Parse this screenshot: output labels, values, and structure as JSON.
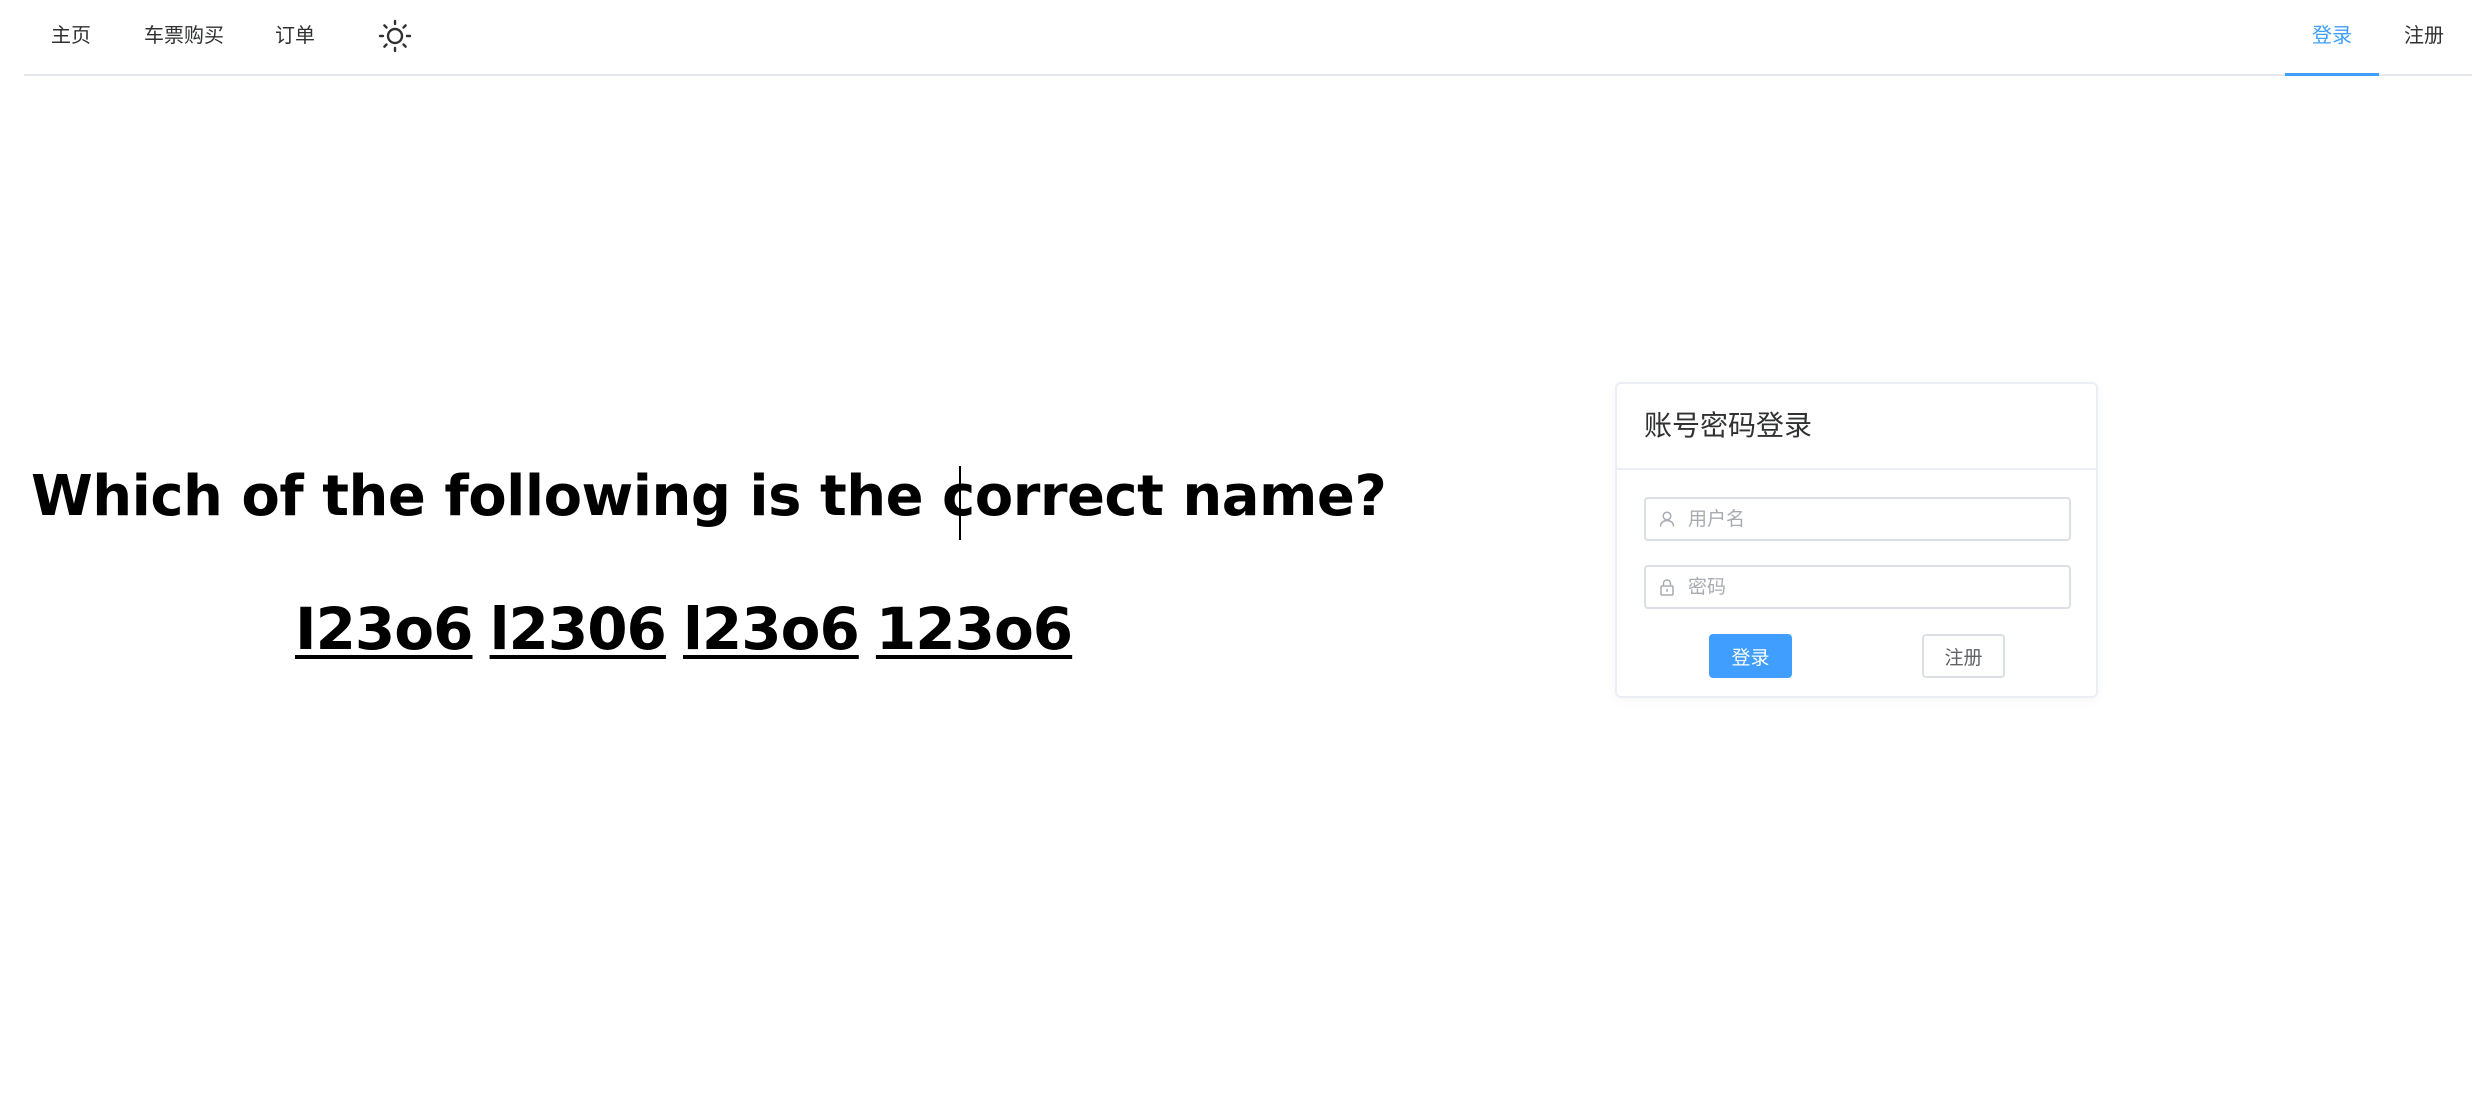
{
  "nav": {
    "home": "主页",
    "tickets": "车票购买",
    "orders": "订单",
    "theme_icon": "sun-icon",
    "login": "登录",
    "register": "注册",
    "active_color": "#409eff"
  },
  "captcha": {
    "question": "Which of the following is the correct name?",
    "options": [
      "I23o6",
      "l2306",
      "l23o6",
      "123o6"
    ]
  },
  "login_card": {
    "title": "账号密码登录",
    "username": {
      "placeholder": "用户名",
      "value": "",
      "icon": "user-icon"
    },
    "password": {
      "placeholder": "密码",
      "value": "",
      "icon": "lock-icon"
    },
    "login_button": "登录",
    "register_button": "注册",
    "primary_color": "#409eff"
  }
}
